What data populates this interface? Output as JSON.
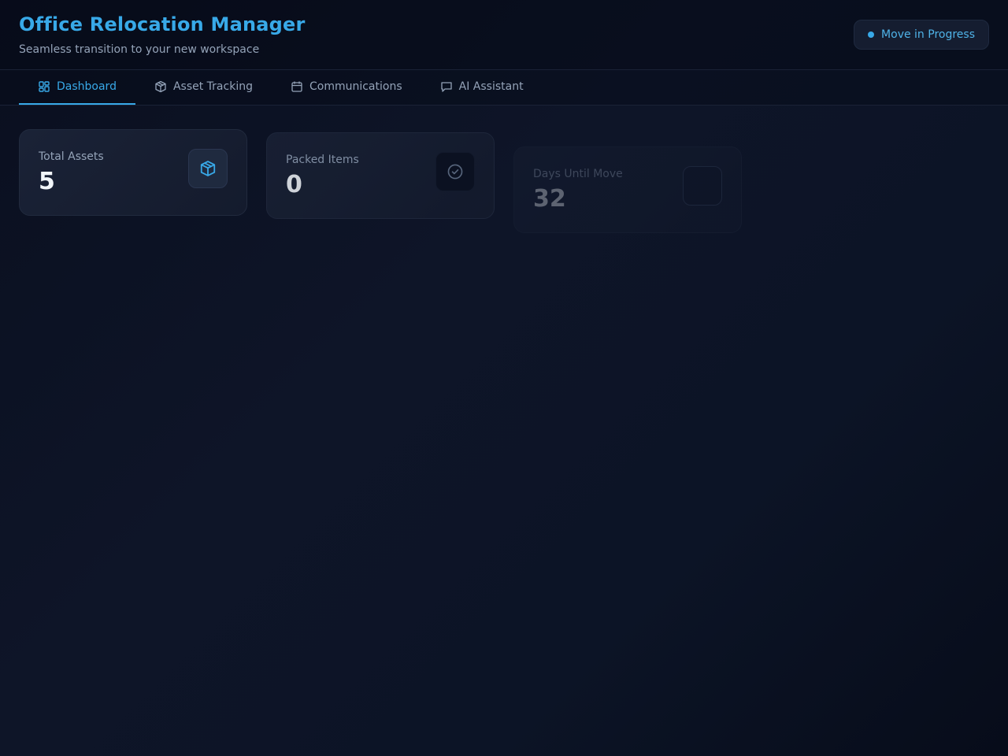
{
  "header": {
    "title": "Office Relocation Manager",
    "subtitle": "Seamless transition to your new workspace",
    "status": "Move in Progress"
  },
  "tabs": [
    {
      "label": "Dashboard",
      "icon": "dashboard-icon",
      "active": true
    },
    {
      "label": "Asset Tracking",
      "icon": "package-icon",
      "active": false
    },
    {
      "label": "Communications",
      "icon": "calendar-icon",
      "active": false
    },
    {
      "label": "AI Assistant",
      "icon": "chat-icon",
      "active": false
    }
  ],
  "stats": [
    {
      "label": "Total Assets",
      "value": "5",
      "icon": "package-icon"
    },
    {
      "label": "Packed Items",
      "value": "0",
      "icon": "check-circle-icon"
    },
    {
      "label": "Days Until Move",
      "value": "32",
      "icon": "calendar-icon"
    }
  ],
  "colors": {
    "accent": "#38a9e8",
    "background": "#0a0f1f",
    "card": "#1a2236",
    "muted_text": "#94a3b8"
  }
}
